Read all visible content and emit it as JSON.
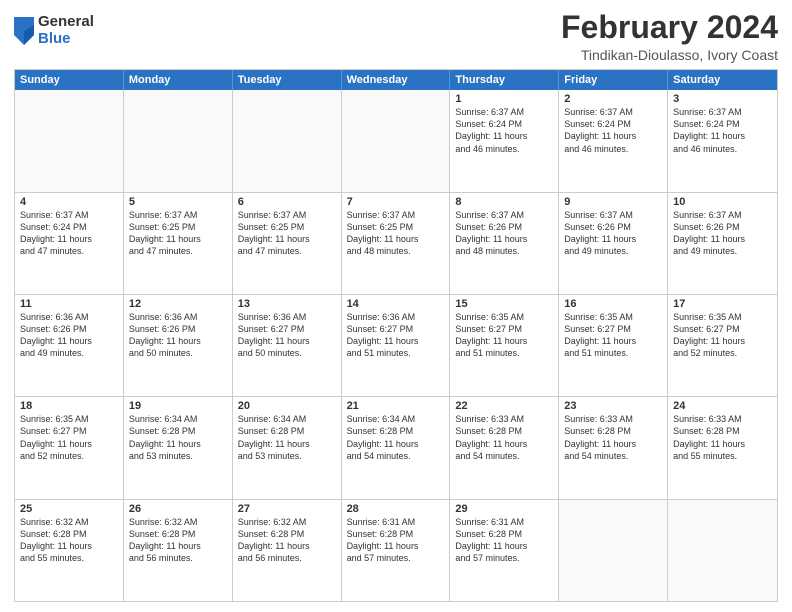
{
  "header": {
    "logo_general": "General",
    "logo_blue": "Blue",
    "main_title": "February 2024",
    "subtitle": "Tindikan-Dioulasso, Ivory Coast"
  },
  "calendar": {
    "days_of_week": [
      "Sunday",
      "Monday",
      "Tuesday",
      "Wednesday",
      "Thursday",
      "Friday",
      "Saturday"
    ],
    "weeks": [
      [
        {
          "day": "",
          "info": ""
        },
        {
          "day": "",
          "info": ""
        },
        {
          "day": "",
          "info": ""
        },
        {
          "day": "",
          "info": ""
        },
        {
          "day": "1",
          "info": "Sunrise: 6:37 AM\nSunset: 6:24 PM\nDaylight: 11 hours\nand 46 minutes."
        },
        {
          "day": "2",
          "info": "Sunrise: 6:37 AM\nSunset: 6:24 PM\nDaylight: 11 hours\nand 46 minutes."
        },
        {
          "day": "3",
          "info": "Sunrise: 6:37 AM\nSunset: 6:24 PM\nDaylight: 11 hours\nand 46 minutes."
        }
      ],
      [
        {
          "day": "4",
          "info": "Sunrise: 6:37 AM\nSunset: 6:24 PM\nDaylight: 11 hours\nand 47 minutes."
        },
        {
          "day": "5",
          "info": "Sunrise: 6:37 AM\nSunset: 6:25 PM\nDaylight: 11 hours\nand 47 minutes."
        },
        {
          "day": "6",
          "info": "Sunrise: 6:37 AM\nSunset: 6:25 PM\nDaylight: 11 hours\nand 47 minutes."
        },
        {
          "day": "7",
          "info": "Sunrise: 6:37 AM\nSunset: 6:25 PM\nDaylight: 11 hours\nand 48 minutes."
        },
        {
          "day": "8",
          "info": "Sunrise: 6:37 AM\nSunset: 6:26 PM\nDaylight: 11 hours\nand 48 minutes."
        },
        {
          "day": "9",
          "info": "Sunrise: 6:37 AM\nSunset: 6:26 PM\nDaylight: 11 hours\nand 49 minutes."
        },
        {
          "day": "10",
          "info": "Sunrise: 6:37 AM\nSunset: 6:26 PM\nDaylight: 11 hours\nand 49 minutes."
        }
      ],
      [
        {
          "day": "11",
          "info": "Sunrise: 6:36 AM\nSunset: 6:26 PM\nDaylight: 11 hours\nand 49 minutes."
        },
        {
          "day": "12",
          "info": "Sunrise: 6:36 AM\nSunset: 6:26 PM\nDaylight: 11 hours\nand 50 minutes."
        },
        {
          "day": "13",
          "info": "Sunrise: 6:36 AM\nSunset: 6:27 PM\nDaylight: 11 hours\nand 50 minutes."
        },
        {
          "day": "14",
          "info": "Sunrise: 6:36 AM\nSunset: 6:27 PM\nDaylight: 11 hours\nand 51 minutes."
        },
        {
          "day": "15",
          "info": "Sunrise: 6:35 AM\nSunset: 6:27 PM\nDaylight: 11 hours\nand 51 minutes."
        },
        {
          "day": "16",
          "info": "Sunrise: 6:35 AM\nSunset: 6:27 PM\nDaylight: 11 hours\nand 51 minutes."
        },
        {
          "day": "17",
          "info": "Sunrise: 6:35 AM\nSunset: 6:27 PM\nDaylight: 11 hours\nand 52 minutes."
        }
      ],
      [
        {
          "day": "18",
          "info": "Sunrise: 6:35 AM\nSunset: 6:27 PM\nDaylight: 11 hours\nand 52 minutes."
        },
        {
          "day": "19",
          "info": "Sunrise: 6:34 AM\nSunset: 6:28 PM\nDaylight: 11 hours\nand 53 minutes."
        },
        {
          "day": "20",
          "info": "Sunrise: 6:34 AM\nSunset: 6:28 PM\nDaylight: 11 hours\nand 53 minutes."
        },
        {
          "day": "21",
          "info": "Sunrise: 6:34 AM\nSunset: 6:28 PM\nDaylight: 11 hours\nand 54 minutes."
        },
        {
          "day": "22",
          "info": "Sunrise: 6:33 AM\nSunset: 6:28 PM\nDaylight: 11 hours\nand 54 minutes."
        },
        {
          "day": "23",
          "info": "Sunrise: 6:33 AM\nSunset: 6:28 PM\nDaylight: 11 hours\nand 54 minutes."
        },
        {
          "day": "24",
          "info": "Sunrise: 6:33 AM\nSunset: 6:28 PM\nDaylight: 11 hours\nand 55 minutes."
        }
      ],
      [
        {
          "day": "25",
          "info": "Sunrise: 6:32 AM\nSunset: 6:28 PM\nDaylight: 11 hours\nand 55 minutes."
        },
        {
          "day": "26",
          "info": "Sunrise: 6:32 AM\nSunset: 6:28 PM\nDaylight: 11 hours\nand 56 minutes."
        },
        {
          "day": "27",
          "info": "Sunrise: 6:32 AM\nSunset: 6:28 PM\nDaylight: 11 hours\nand 56 minutes."
        },
        {
          "day": "28",
          "info": "Sunrise: 6:31 AM\nSunset: 6:28 PM\nDaylight: 11 hours\nand 57 minutes."
        },
        {
          "day": "29",
          "info": "Sunrise: 6:31 AM\nSunset: 6:28 PM\nDaylight: 11 hours\nand 57 minutes."
        },
        {
          "day": "",
          "info": ""
        },
        {
          "day": "",
          "info": ""
        }
      ]
    ]
  }
}
